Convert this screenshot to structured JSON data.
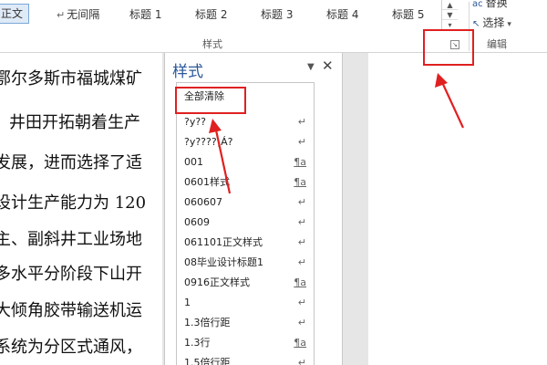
{
  "ribbon": {
    "styles_gallery": [
      {
        "label": "正文",
        "mark": "",
        "selected": true
      },
      {
        "label": "无间隔",
        "mark": "↵"
      },
      {
        "label": "标题 1",
        "mark": ""
      },
      {
        "label": "标题 2",
        "mark": ""
      },
      {
        "label": "标题 3",
        "mark": ""
      },
      {
        "label": "标题 4",
        "mark": ""
      },
      {
        "label": "标题 5",
        "mark": ""
      }
    ],
    "styles_group_label": "样式",
    "editing_group_label": "编辑",
    "replace_label": "替换",
    "select_label": "选择"
  },
  "document": {
    "lines": [
      "鄂尔多斯市福城煤矿",
      "井田开拓朝着生产",
      "发展，进而选择了适",
      "设计生产能力为 120",
      "主、副斜井工业场地",
      "多水平分阶段下山开",
      "大倾角胶带输送机运",
      "系统为分区式通风，"
    ]
  },
  "styles_pane": {
    "title": "样式",
    "clear_all": "全部清除",
    "items": [
      {
        "label": "?y??",
        "symbol": "↵"
      },
      {
        "label": "?y????¡Á?",
        "symbol": "↵"
      },
      {
        "label": "001",
        "symbol": "¶a"
      },
      {
        "label": "0601样式",
        "symbol": "¶a"
      },
      {
        "label": "060607",
        "symbol": "↵"
      },
      {
        "label": "0609",
        "symbol": "↵"
      },
      {
        "label": "061101正文样式",
        "symbol": "↵"
      },
      {
        "label": "08毕业设计标题1",
        "symbol": "↵"
      },
      {
        "label": "0916正文样式",
        "symbol": "¶a"
      },
      {
        "label": "1",
        "symbol": "↵"
      },
      {
        "label": "1.3倍行距",
        "symbol": "↵"
      },
      {
        "label": "1.3行",
        "symbol": "¶a"
      },
      {
        "label": "1.5倍行距",
        "symbol": "↵"
      }
    ]
  },
  "annotation_color": "#e02020"
}
